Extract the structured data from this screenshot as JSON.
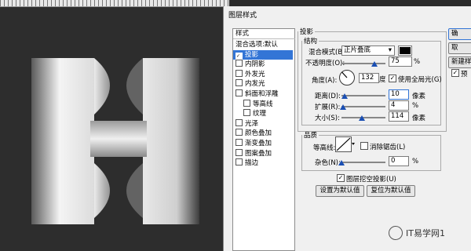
{
  "dialog": {
    "title": "图层样式"
  },
  "style_list": {
    "header": "样式",
    "items": [
      {
        "label": "混合选项:默认",
        "checkbox": false,
        "indent": false,
        "selected": false
      },
      {
        "label": "投影",
        "checkbox": true,
        "checked": true,
        "indent": false,
        "selected": true
      },
      {
        "label": "内阴影",
        "checkbox": true,
        "checked": false,
        "indent": false,
        "selected": false
      },
      {
        "label": "外发光",
        "checkbox": true,
        "checked": false,
        "indent": false,
        "selected": false
      },
      {
        "label": "内发光",
        "checkbox": true,
        "checked": false,
        "indent": false,
        "selected": false
      },
      {
        "label": "斜面和浮雕",
        "checkbox": true,
        "checked": false,
        "indent": false,
        "selected": false
      },
      {
        "label": "等高线",
        "checkbox": true,
        "checked": false,
        "indent": true,
        "selected": false
      },
      {
        "label": "纹理",
        "checkbox": true,
        "checked": false,
        "indent": true,
        "selected": false
      },
      {
        "label": "光泽",
        "checkbox": true,
        "checked": false,
        "indent": false,
        "selected": false
      },
      {
        "label": "颜色叠加",
        "checkbox": true,
        "checked": false,
        "indent": false,
        "selected": false
      },
      {
        "label": "渐变叠加",
        "checkbox": true,
        "checked": false,
        "indent": false,
        "selected": false
      },
      {
        "label": "图案叠加",
        "checkbox": true,
        "checked": false,
        "indent": false,
        "selected": false
      },
      {
        "label": "描边",
        "checkbox": true,
        "checked": false,
        "indent": false,
        "selected": false
      }
    ]
  },
  "shadow": {
    "title": "投影",
    "structure_title": "结构",
    "blend_mode_label": "混合模式(B):",
    "blend_mode_value": "正片叠底",
    "blend_color": "#000000",
    "opacity_label": "不透明度(O):",
    "opacity_value": "75",
    "opacity_unit": "%",
    "angle_label": "角度(A):",
    "angle_value": "132",
    "angle_unit": "度",
    "global_light_label": "使用全局光(G)",
    "global_light_checked": true,
    "distance_label": "距离(D):",
    "distance_value": "10",
    "distance_unit": "像素",
    "spread_label": "扩展(R):",
    "spread_value": "4",
    "spread_unit": "%",
    "size_label": "大小(S):",
    "size_value": "114",
    "size_unit": "像素",
    "quality_title": "品质",
    "contour_label": "等高线:",
    "antialias_label": "消除锯齿(L)",
    "noise_label": "杂色(N):",
    "noise_value": "0",
    "noise_unit": "%",
    "knockout_label": "图层挖空投影(U)",
    "knockout_checked": true,
    "set_default_label": "设置为默认值",
    "reset_default_label": "复位为默认值"
  },
  "side_buttons": {
    "ok": "确",
    "cancel": "取",
    "new_style": "新建样",
    "preview": "预",
    "preview_checked": true
  },
  "watermark": {
    "text": "IT易学网1"
  }
}
